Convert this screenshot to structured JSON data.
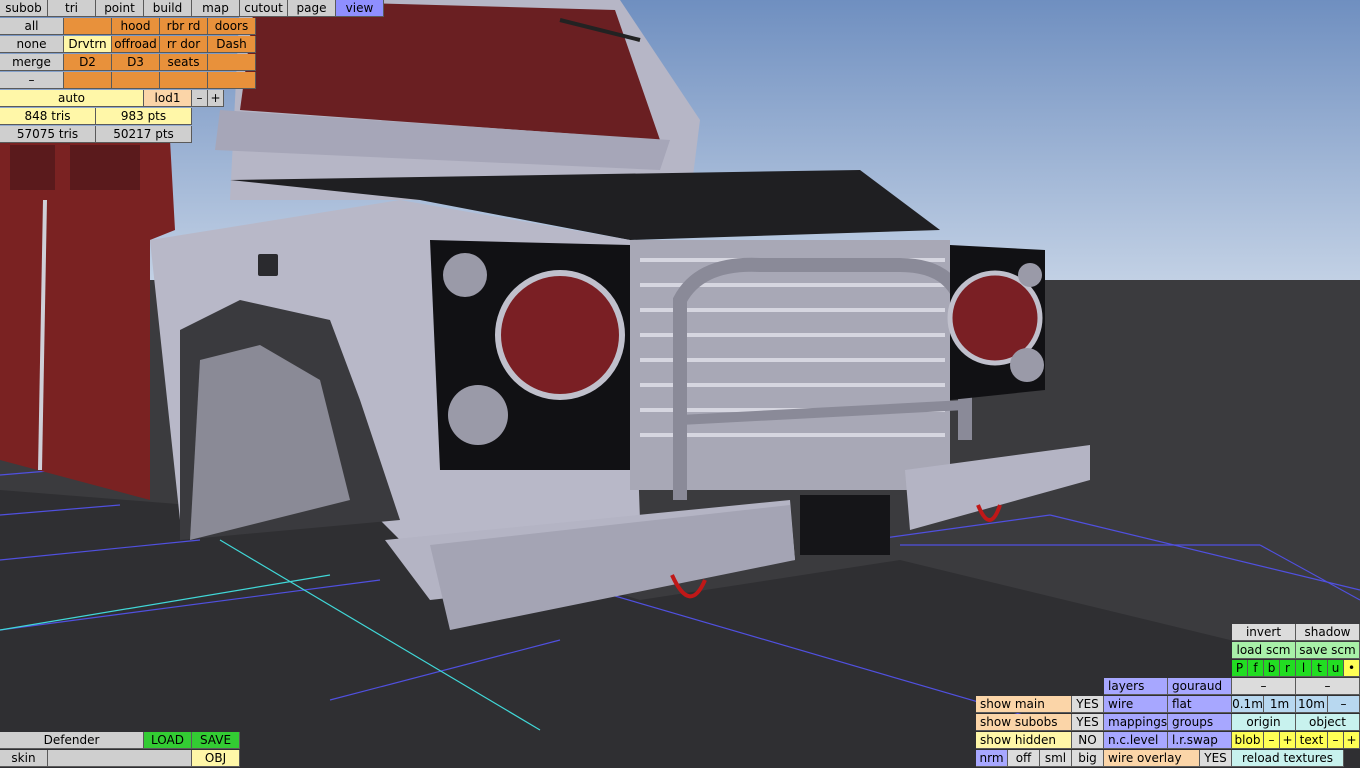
{
  "top_menu": [
    "subob",
    "tri",
    "point",
    "build",
    "map",
    "cutout",
    "page",
    "view"
  ],
  "top_menu_active": "view",
  "subobject_grid": {
    "col1": [
      "all",
      "none",
      "merge",
      "–"
    ],
    "row1": [
      "",
      "hood",
      "rbr rd",
      "doors"
    ],
    "row2": [
      "Drvtrn",
      "offroad",
      "rr dor",
      "Dash"
    ],
    "row3": [
      "D2",
      "D3",
      "seats",
      ""
    ],
    "row4": [
      "",
      "",
      "",
      ""
    ]
  },
  "lod": {
    "auto": "auto",
    "lod": "lod1",
    "minus": "–",
    "plus": "+"
  },
  "stats": {
    "sel_tris": "848 tris",
    "sel_pts": "983 pts",
    "total_tris": "57075 tris",
    "total_pts": "50217 pts"
  },
  "file": {
    "name": "Defender",
    "load": "LOAD",
    "save": "SAVE",
    "skin": "skin",
    "skin_value": "",
    "obj": "OBJ"
  },
  "show_toggles": [
    {
      "label": "show main",
      "value": "YES"
    },
    {
      "label": "show subobs",
      "value": "YES"
    },
    {
      "label": "show hidden",
      "value": "NO"
    }
  ],
  "normals": [
    "nrm",
    "off",
    "sml",
    "big"
  ],
  "render_col1": [
    "layers",
    "wire",
    "mappings",
    "n.c.level",
    "wire overlay"
  ],
  "render_col2": [
    "gouraud",
    "flat",
    "groups",
    "l.r.swap",
    "YES"
  ],
  "right_panel": {
    "invert": "invert",
    "shadow": "shadow",
    "load_scm": "load scm",
    "save_scm": "save scm",
    "views": [
      "P",
      "f",
      "b",
      "r",
      "l",
      "t",
      "u",
      "•"
    ],
    "dash_left": "–",
    "dash_right": "–",
    "grid_sizes": [
      "0.1m",
      "1m",
      "10m",
      "–"
    ],
    "origin": "origin",
    "object": "object",
    "blob": "blob",
    "blob_minus": "–",
    "blob_plus": "+",
    "text": "text",
    "text_minus": "–",
    "text_plus": "+",
    "reload": "reload textures"
  },
  "colors": {
    "sky": "#9fb6d6",
    "ground": "#3a3a3d",
    "body_red": "#7a2222",
    "body_grey": "#b9b9c8"
  }
}
